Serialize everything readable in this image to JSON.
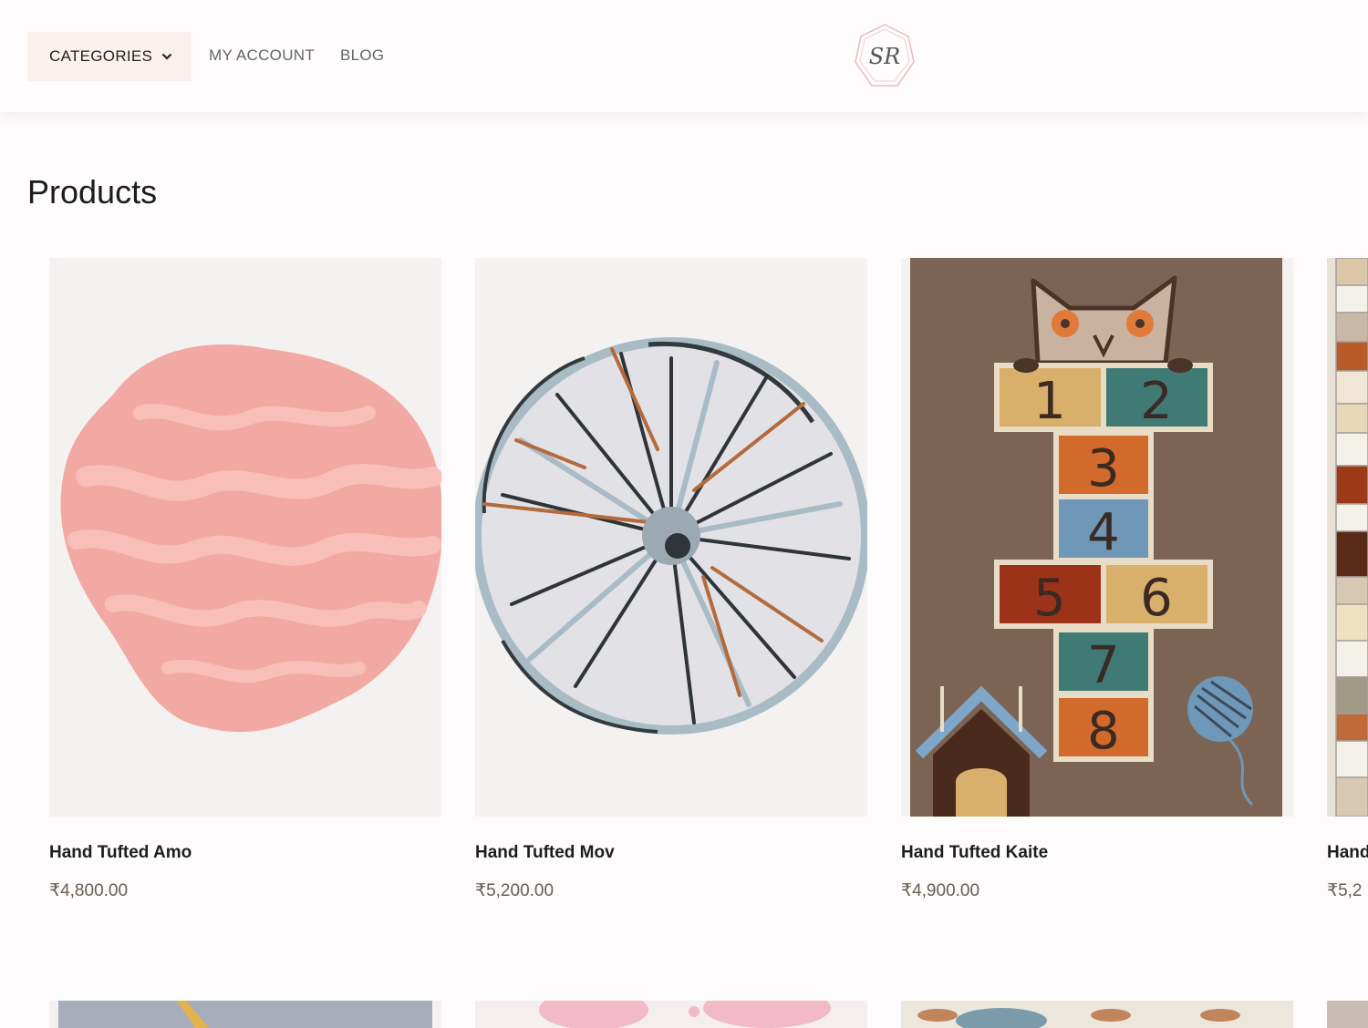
{
  "header": {
    "categories_label": "CATEGORIES",
    "nav": [
      "MY ACCOUNT",
      "BLOG"
    ],
    "logo_text": "SR"
  },
  "page_title": "Products",
  "products": [
    {
      "name": "Hand Tufted Amo",
      "price": "₹4,800.00",
      "image": "pink organic wave rug"
    },
    {
      "name": "Hand Tufted Mov",
      "price": "₹5,200.00",
      "image": "round burst rug"
    },
    {
      "name": "Hand Tufted Kaite",
      "price": "₹4,900.00",
      "image": "cat hopscotch rug"
    },
    {
      "name": "Hand",
      "price": "₹5,2",
      "image": "geometric hexagon rug"
    }
  ],
  "hopscotch_numbers": [
    "1",
    "2",
    "3",
    "4",
    "5",
    "6",
    "7",
    "8"
  ],
  "colors": {
    "accent_bg": "#fbf1ec",
    "price": "#6b5d55",
    "card_bg": "#f4f1f1"
  }
}
